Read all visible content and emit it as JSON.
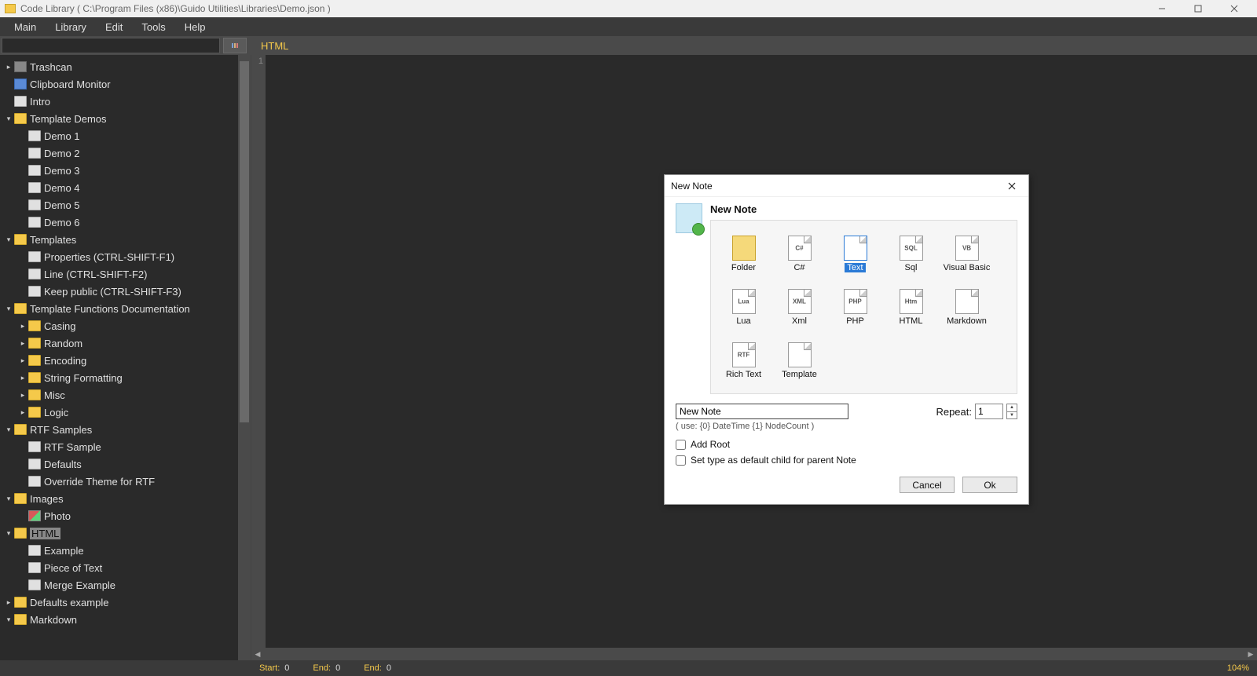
{
  "window": {
    "title": "Code Library ( C:\\Program Files (x86)\\Guido Utilities\\Libraries\\Demo.json )"
  },
  "menu": [
    "Main",
    "Library",
    "Edit",
    "Tools",
    "Help"
  ],
  "tabs": {
    "active": "HTML"
  },
  "editor": {
    "line1": "1"
  },
  "tree": [
    {
      "d": 0,
      "icon": "trash",
      "label": "Trashcan",
      "exp": "+",
      "expandable": true
    },
    {
      "d": 0,
      "icon": "clip",
      "label": "Clipboard Monitor",
      "exp": ""
    },
    {
      "d": 0,
      "icon": "file",
      "label": "Intro",
      "exp": ""
    },
    {
      "d": 0,
      "icon": "folder",
      "label": "Template Demos",
      "exp": "-",
      "expandable": true
    },
    {
      "d": 1,
      "icon": "file",
      "label": "Demo 1"
    },
    {
      "d": 1,
      "icon": "file",
      "label": "Demo 2"
    },
    {
      "d": 1,
      "icon": "file",
      "label": "Demo 3"
    },
    {
      "d": 1,
      "icon": "file",
      "label": "Demo 4"
    },
    {
      "d": 1,
      "icon": "file",
      "label": "Demo 5"
    },
    {
      "d": 1,
      "icon": "file",
      "label": "Demo 6"
    },
    {
      "d": 0,
      "icon": "folder",
      "label": "Templates",
      "exp": "-",
      "expandable": true
    },
    {
      "d": 1,
      "icon": "file",
      "label": "Properties (CTRL-SHIFT-F1)"
    },
    {
      "d": 1,
      "icon": "file",
      "label": "Line (CTRL-SHIFT-F2)"
    },
    {
      "d": 1,
      "icon": "file",
      "label": "Keep public (CTRL-SHIFT-F3)"
    },
    {
      "d": 0,
      "icon": "folder",
      "label": "Template Functions Documentation",
      "exp": "-",
      "expandable": true
    },
    {
      "d": 1,
      "icon": "folder",
      "label": "Casing",
      "exp": "+",
      "expandable": true
    },
    {
      "d": 1,
      "icon": "folder",
      "label": "Random",
      "exp": "+",
      "expandable": true
    },
    {
      "d": 1,
      "icon": "folder",
      "label": "Encoding",
      "exp": "+",
      "expandable": true
    },
    {
      "d": 1,
      "icon": "folder",
      "label": "String Formatting",
      "exp": "+",
      "expandable": true
    },
    {
      "d": 1,
      "icon": "folder",
      "label": "Misc",
      "exp": "+",
      "expandable": true
    },
    {
      "d": 1,
      "icon": "folder",
      "label": "Logic",
      "exp": "+",
      "expandable": true
    },
    {
      "d": 0,
      "icon": "folder",
      "label": "RTF Samples",
      "exp": "-",
      "expandable": true
    },
    {
      "d": 1,
      "icon": "file",
      "label": "RTF Sample"
    },
    {
      "d": 1,
      "icon": "file",
      "label": "Defaults"
    },
    {
      "d": 1,
      "icon": "file",
      "label": "Override Theme for RTF"
    },
    {
      "d": 0,
      "icon": "folder",
      "label": "Images",
      "exp": "-",
      "expandable": true
    },
    {
      "d": 1,
      "icon": "photo",
      "label": "Photo"
    },
    {
      "d": 0,
      "icon": "folder",
      "label": "HTML",
      "exp": "-",
      "selected": true,
      "expandable": true
    },
    {
      "d": 1,
      "icon": "file",
      "label": "Example"
    },
    {
      "d": 1,
      "icon": "file",
      "label": "Piece of Text"
    },
    {
      "d": 1,
      "icon": "file",
      "label": "Merge Example"
    },
    {
      "d": 0,
      "icon": "folder",
      "label": "Defaults example",
      "exp": "+",
      "expandable": true
    },
    {
      "d": 0,
      "icon": "folder",
      "label": "Markdown",
      "exp": "-",
      "expandable": true
    }
  ],
  "dialog": {
    "title": "New Note",
    "heading": "New Note",
    "types": [
      {
        "label": "Folder",
        "cls": "folder",
        "badge": ""
      },
      {
        "label": "C#",
        "badge": "C#"
      },
      {
        "label": "Text",
        "selected": true,
        "badge": ""
      },
      {
        "label": "Sql",
        "badge": "SQL"
      },
      {
        "label": "Visual Basic",
        "badge": "VB"
      },
      {
        "label": "Lua",
        "badge": "Lua"
      },
      {
        "label": "Xml",
        "badge": "XML"
      },
      {
        "label": "PHP",
        "badge": "PHP"
      },
      {
        "label": "HTML",
        "badge": "Htm"
      },
      {
        "label": "Markdown",
        "badge": ""
      },
      {
        "label": "Rich Text",
        "badge": "RTF"
      },
      {
        "label": "Template",
        "badge": ""
      }
    ],
    "name_value": "New Note",
    "repeat_label": "Repeat:",
    "repeat_value": "1",
    "hint": "( use: {0} DateTime {1} NodeCount )",
    "check1": "Add Root",
    "check2": "Set type as default child for parent Note",
    "cancel": "Cancel",
    "ok": "Ok"
  },
  "status": {
    "start_label": "Start:",
    "start_val": "0",
    "end1_label": "End:",
    "end1_val": "0",
    "end2_label": "End:",
    "end2_val": "0",
    "zoom": "104%"
  }
}
